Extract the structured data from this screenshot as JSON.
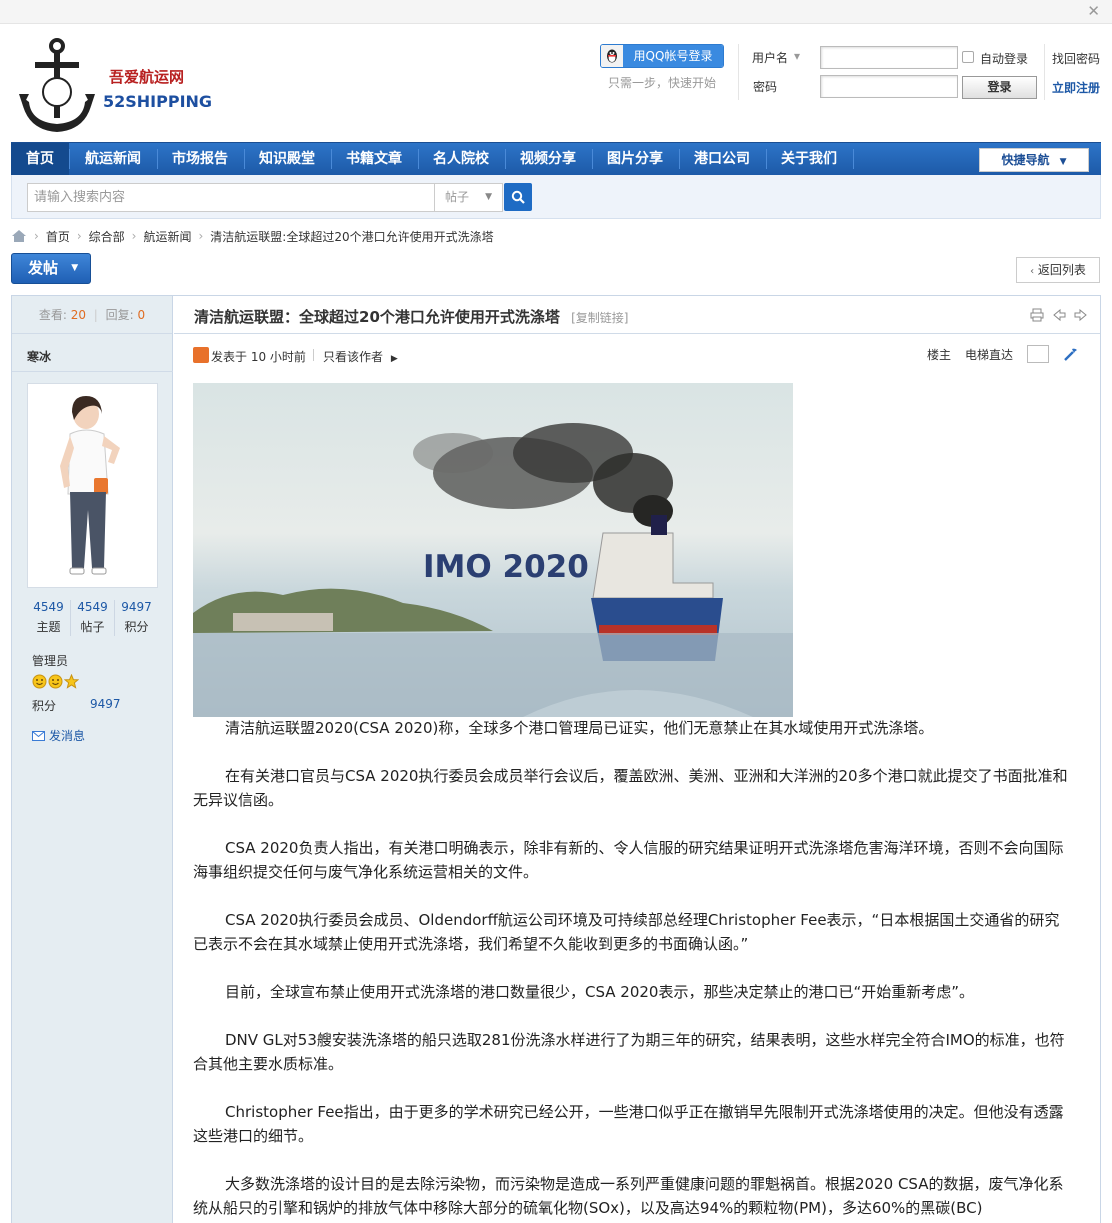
{
  "header": {
    "brand_cn": "吾爱航运网",
    "brand_en": "52SHIPPING",
    "qq_login_label": "用QQ帐号登录",
    "qq_hint": "只需一步，快速开始",
    "username_label": "用户名",
    "password_label": "密码",
    "auto_login_label": "自动登录",
    "login_button": "登录",
    "forgot_password": "找回密码",
    "register": "立即注册"
  },
  "nav": {
    "items": [
      {
        "label": "首页"
      },
      {
        "label": "航运新闻"
      },
      {
        "label": "市场报告"
      },
      {
        "label": "知识殿堂"
      },
      {
        "label": "书籍文章"
      },
      {
        "label": "名人院校"
      },
      {
        "label": "视频分享"
      },
      {
        "label": "图片分享"
      },
      {
        "label": "港口公司"
      },
      {
        "label": "关于我们"
      }
    ],
    "quick_nav": "快捷导航"
  },
  "search": {
    "placeholder": "请输入搜索内容",
    "type": "帖子"
  },
  "breadcrumb": {
    "items": [
      "首页",
      "综合部",
      "航运新闻",
      "清洁航运联盟:全球超过20个港口允许使用开式洗涤塔"
    ]
  },
  "actions": {
    "post_button": "发帖",
    "back_to_list": "返回列表"
  },
  "sidebar": {
    "views_label": "查看:",
    "views": "20",
    "replies_label": "回复:",
    "replies": "0",
    "author": "寒冰",
    "stats": [
      {
        "value": "4549",
        "label": "主题"
      },
      {
        "value": "4549",
        "label": "帖子"
      },
      {
        "value": "9497",
        "label": "积分"
      }
    ],
    "role": "管理员",
    "credit_label": "积分",
    "credit_value": "9497",
    "send_message": "发消息"
  },
  "post": {
    "title": "清洁航运联盟：全球超过20个港口允许使用开式洗涤塔",
    "copy_link": "[复制链接]",
    "posted_at": "发表于 10 小时前",
    "only_author": "只看该作者",
    "floor_owner": "楼主",
    "elevator": "电梯直达",
    "hero_text": "IMO 2020",
    "paragraphs": [
      "清洁航运联盟2020(CSA 2020)称，全球多个港口管理局已证实，他们无意禁止在其水域使用开式洗涤塔。",
      "在有关港口官员与CSA 2020执行委员会成员举行会议后，覆盖欧洲、美洲、亚洲和大洋洲的20多个港口就此提交了书面批准和无异议信函。",
      "CSA 2020负责人指出，有关港口明确表示，除非有新的、令人信服的研究结果证明开式洗涤塔危害海洋环境，否则不会向国际海事组织提交任何与废气净化系统运营相关的文件。",
      "CSA 2020执行委员会成员、Oldendorff航运公司环境及可持续部总经理Christopher Fee表示，“日本根据国土交通省的研究已表示不会在其水域禁止使用开式洗涤塔，我们希望不久能收到更多的书面确认函。”",
      "目前，全球宣布禁止使用开式洗涤塔的港口数量很少，CSA 2020表示，那些决定禁止的港口已“开始重新考虑”。",
      "DNV GL对53艘安装洗涤塔的船只选取281份洗涤水样进行了为期三年的研究，结果表明，这些水样完全符合IMO的标准，也符合其他主要水质标准。",
      "Christopher Fee指出，由于更多的学术研究已经公开，一些港口似乎正在撤销早先限制开式洗涤塔使用的决定。但他没有透露这些港口的细节。",
      "大多数洗涤塔的设计目的是去除污染物，而污染物是造成一系列严重健康问题的罪魁祸首。根据2020 CSA的数据，废气净化系统从船只的引擎和锅炉的排放气体中移除大部分的硫氧化物(SOx)，以及高达94%的颗粒物(PM)，多达60%的黑碳(BC)"
    ]
  },
  "colors": {
    "nav_blue": "#1d5aa8",
    "link_blue": "#1d58a6",
    "accent_orange": "#e06c22",
    "sidebar_bg": "#e5edf2"
  }
}
